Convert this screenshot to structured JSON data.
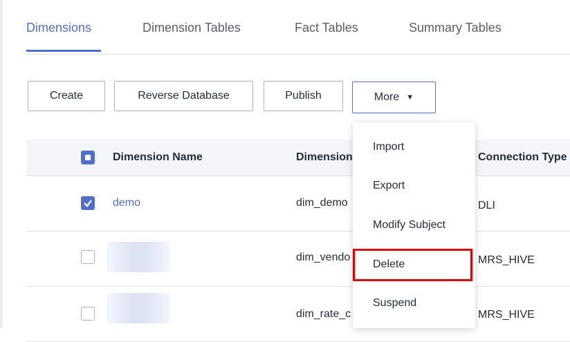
{
  "tabs": [
    {
      "label": "Dimensions",
      "active": true
    },
    {
      "label": "Dimension Tables",
      "active": false
    },
    {
      "label": "Fact Tables",
      "active": false
    },
    {
      "label": "Summary Tables",
      "active": false
    }
  ],
  "toolbar": {
    "create": "Create",
    "reverse_database": "Reverse Database",
    "publish": "Publish",
    "more": "More",
    "more_icon": "caret-down-icon"
  },
  "table": {
    "headers": [
      "Dimension Name",
      "Dimension",
      "Connection Type"
    ],
    "header_checkbox": "partial",
    "rows": [
      {
        "checked": true,
        "name": "demo",
        "dimension": "dim_demo",
        "connection": "DLI"
      },
      {
        "checked": false,
        "name": "",
        "dimension": "dim_vendo",
        "connection": "MRS_HIVE"
      },
      {
        "checked": false,
        "name": "",
        "dimension": "dim_rate_c",
        "connection": "MRS_HIVE"
      }
    ]
  },
  "more_menu": {
    "items": [
      "Import",
      "Export",
      "Modify Subject",
      "Delete",
      "Suspend"
    ],
    "highlighted": "Delete"
  },
  "colors": {
    "accent": "#526ecc",
    "highlight_box": "#e00000"
  }
}
